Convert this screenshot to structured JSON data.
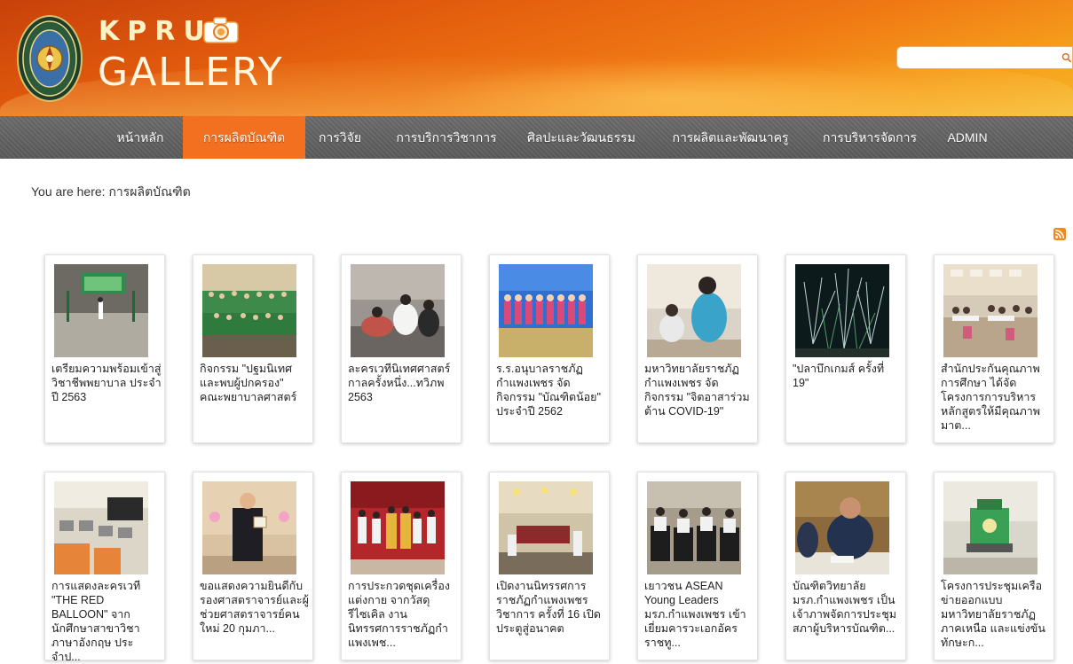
{
  "header": {
    "brand_top": "KPRU",
    "brand_bottom": "GALLERY",
    "logo_icon": "kpru-seal-icon",
    "camera_icon": "camera-icon",
    "search": {
      "value": "",
      "placeholder": "",
      "icon": "search-icon"
    }
  },
  "nav": {
    "items": [
      {
        "label": "หน้าหลัก",
        "active": false
      },
      {
        "label": "การผลิตบัณฑิต",
        "active": true
      },
      {
        "label": "การวิจัย",
        "active": false
      },
      {
        "label": "การบริการวิชาการ",
        "active": false
      },
      {
        "label": "ศิลปะและวัฒนธรรม",
        "active": false
      },
      {
        "label": "การผลิตและพัฒนาครู",
        "active": false
      },
      {
        "label": "การบริหารจัดการ",
        "active": false
      },
      {
        "label": "ADMIN",
        "active": false
      }
    ],
    "active_color": "#f37021"
  },
  "breadcrumb": {
    "prefix": "You are here: ",
    "current": "การผลิตบัณฑิต"
  },
  "rss_icon": "rss-icon",
  "gallery": {
    "items": [
      {
        "caption": "เตรียมความพร้อมเข้าสู่วิชาชีพพยาบาล ประจำปี 2563",
        "thumb": "stage-ceremony"
      },
      {
        "caption": "กิจกรรม \"ปฐมนิเทศและพบผู้ปกครอง\" คณะพยาบาลศาสตร์",
        "thumb": "group-photo-green"
      },
      {
        "caption": "ละครเวทีนิเทศศาสตร์ กาลครั้งหนึ่ง...ทวิภพ 2563",
        "thumb": "stage-play-floor"
      },
      {
        "caption": "ร.ร.อนุบาลราชภัฏกำแพงเพชร จัดกิจกรรม \"บัณฑิตน้อย\" ประจำปี 2562",
        "thumb": "children-graduation"
      },
      {
        "caption": "มหาวิทยาลัยราชภัฏกำแพงเพชร จัดกิจกรรม \"จิตอาสาร่วมต้าน COVID-19\"",
        "thumb": "volunteer-covid"
      },
      {
        "caption": "\"ปลาบึกเกมส์ ครั้งที่ 19\"",
        "thumb": "fireworks"
      },
      {
        "caption": "สำนักประกันคุณภาพการศึกษา ได้จัดโครงการการบริหารหลักสูตรให้มีคุณภาพมาต...",
        "thumb": "meeting-hall"
      },
      {
        "caption": "การแสดงละครเวที \"THE RED BALLOON\" จากนักศึกษาสาขาวิชาภาษาอังกฤษ ประจำป...",
        "thumb": "computer-lab"
      },
      {
        "caption": "ขอแสดงความยินดีกับรองศาสตราจารย์และผู้ช่วยศาสตราจารย์คนใหม่ 20 กุมภา...",
        "thumb": "portrait-award"
      },
      {
        "caption": "การประกวดชุดเครื่องแต่งกาย จากวัสดุรีไซเคิล งานนิทรรศการราชภัฏกำแพงเพช...",
        "thumb": "costume-contest"
      },
      {
        "caption": "เปิดงานนิทรรศการราชภัฏกำแพงเพชร วิชาการ ครั้งที่ 16 เปิดประตูสู่อนาคต",
        "thumb": "exhibition"
      },
      {
        "caption": "เยาวชน ASEAN Young Leaders มรภ.กำแพงเพชร เข้าเยี่ยมคารวะเอกอัครราชทู...",
        "thumb": "students-seminar"
      },
      {
        "caption": "บัณฑิตวิทยาลัย มรภ.กำแพงเพชร เป็นเจ้าภาพจัดการประชุมสภาผู้บริหารบัณฑิต...",
        "thumb": "executive-meeting"
      },
      {
        "caption": "โครงการประชุมเครือข่ายออกแบบ มหาวิทยาลัยราชภัฏภาคเหนือ และแข่งขันทักษะก...",
        "thumb": "robot-device"
      }
    ]
  }
}
